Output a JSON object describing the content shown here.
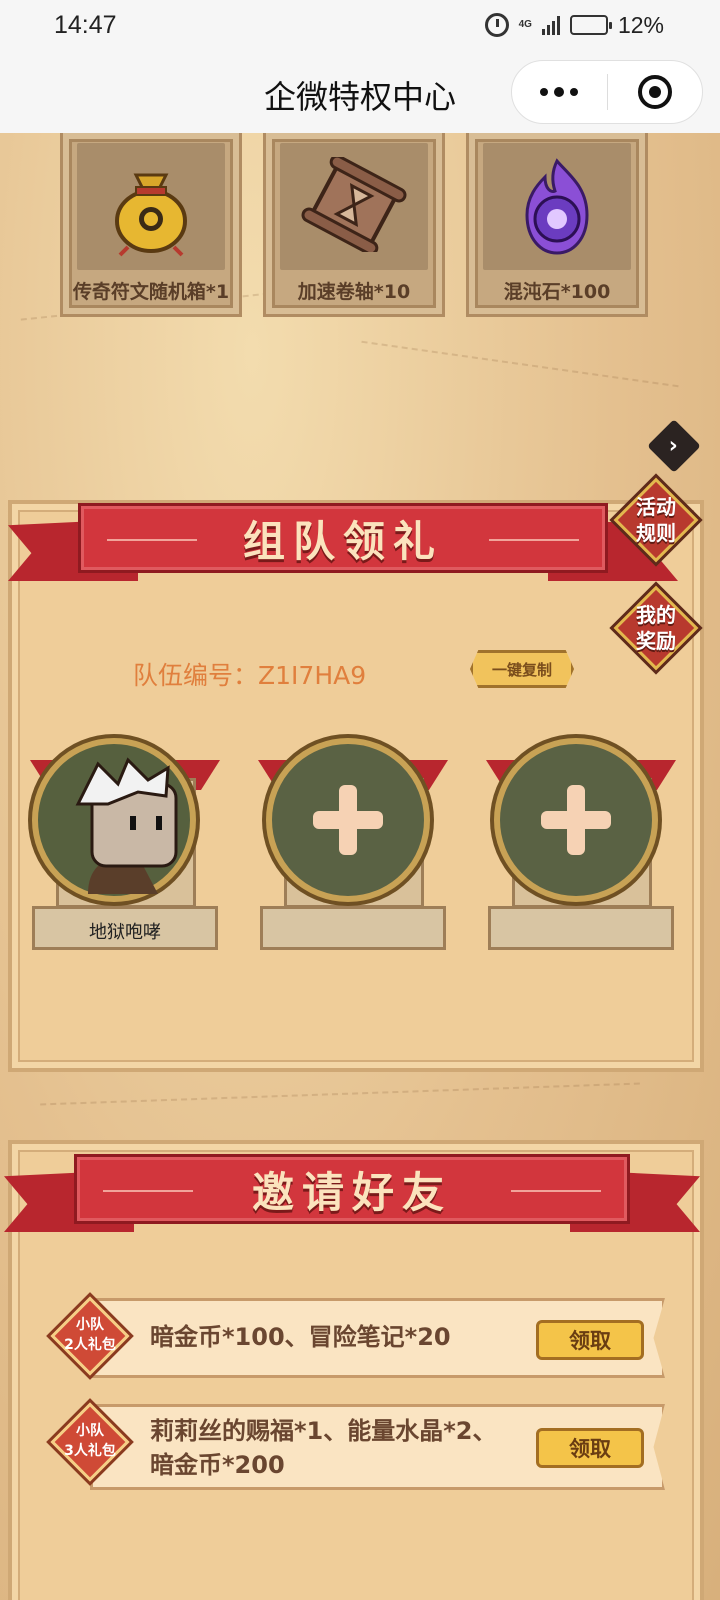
{
  "status": {
    "time": "14:47",
    "network": "4G",
    "battery": "12%"
  },
  "title_bar": {
    "title": "企微特权中心"
  },
  "rewards": [
    {
      "label": "传奇符文随机箱*1",
      "icon": "treasure-bag-icon"
    },
    {
      "label": "加速卷轴*10",
      "icon": "scroll-icon"
    },
    {
      "label": "混沌石*100",
      "icon": "purple-flame-icon"
    }
  ],
  "team_section": {
    "title": "组队领礼",
    "rules_button": "活动规则",
    "my_rewards_button": "我的奖励",
    "team_id_label": "队伍编号：",
    "team_id": "Z1I7HA9",
    "copy_button": "一键复制",
    "members": [
      {
        "name": "地狱咆哮",
        "filled": true
      },
      {
        "name": "",
        "filled": false
      },
      {
        "name": "",
        "filled": false
      }
    ]
  },
  "invite_section": {
    "title": "邀请好友",
    "gifts": [
      {
        "badge_line1": "小队",
        "badge_line2": "2人礼包",
        "line1": "暗金币*100、冒险笔记*20",
        "line2": "",
        "button": "领取"
      },
      {
        "badge_line1": "小队",
        "badge_line2": "3人礼包",
        "line1": "莉莉丝的赐福*1、能量水晶*2、",
        "line2": "暗金币*200",
        "button": "领取"
      }
    ]
  },
  "colors": {
    "banner_red": "#d2363d",
    "claim_yellow": "#f4c449",
    "team_id_orange": "#e07f3d"
  }
}
